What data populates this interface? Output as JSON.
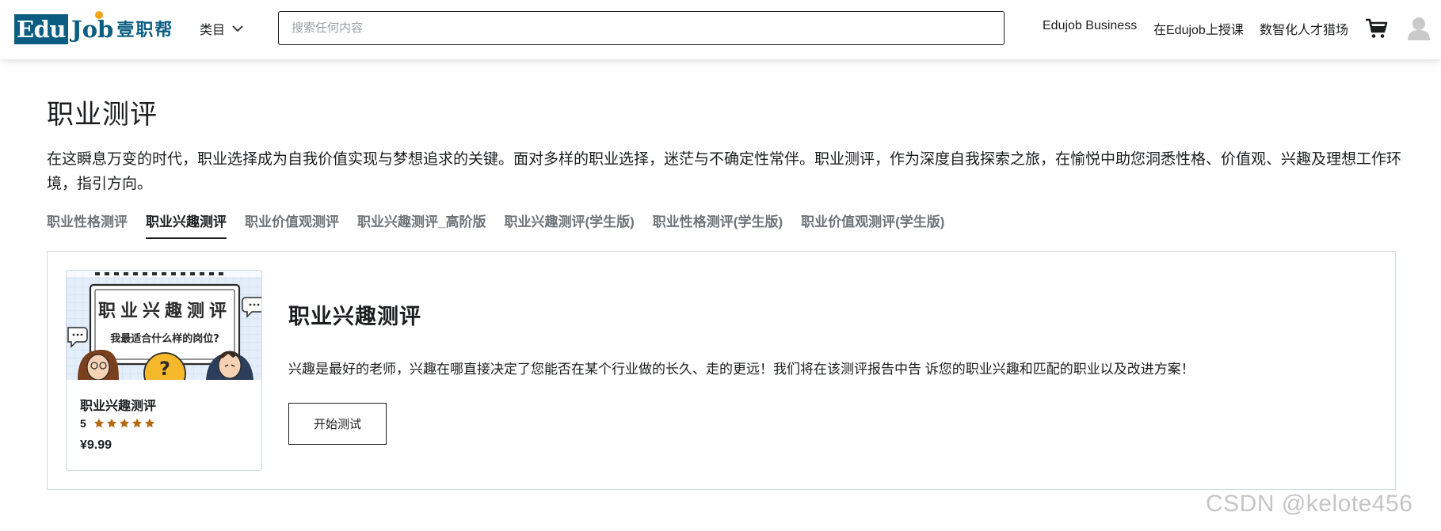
{
  "header": {
    "logo": {
      "edu": "Edu",
      "job": "Job",
      "cn": "壹职帮"
    },
    "category_label": "类目",
    "search_placeholder": "搜索任何内容",
    "links": [
      "Edujob Business",
      "在Edujob上授课",
      "数智化人才猎场"
    ]
  },
  "page": {
    "title": "职业测评",
    "intro": "在这瞬息万变的时代，职业选择成为自我价值实现与梦想追求的关键。面对多样的职业选择，迷茫与不确定性常伴。职业测评，作为深度自我探索之旅，在愉悦中助您洞悉性格、价值观、兴趣及理想工作环境，指引方向。"
  },
  "tabs": [
    {
      "label": "职业性格测评",
      "active": false
    },
    {
      "label": "职业兴趣测评",
      "active": true
    },
    {
      "label": "职业价值观测评",
      "active": false
    },
    {
      "label": "职业兴趣测评_高阶版",
      "active": false
    },
    {
      "label": "职业兴趣测评(学生版)",
      "active": false
    },
    {
      "label": "职业性格测评(学生版)",
      "active": false
    },
    {
      "label": "职业价值观测评(学生版)",
      "active": false
    }
  ],
  "card": {
    "image_heading": "职业兴趣测评",
    "image_subheading": "我最适合什么样的岗位?",
    "image_mark": "?",
    "title": "职业兴趣测评",
    "rating": "5",
    "stars": 5,
    "price": "¥9.99"
  },
  "detail": {
    "title": "职业兴趣测评",
    "description": "兴趣是最好的老师，兴趣在哪直接决定了您能否在某个行业做的长久、走的更远！我们将在该测评报告中告 诉您的职业兴趣和匹配的职业以及改进方案！",
    "button_label": "开始测试"
  },
  "watermark": "CSDN @kelote456",
  "colors": {
    "brand": "#0b5e82",
    "accent": "#f2a516",
    "star": "#b4690e"
  },
  "icons": {
    "category": "chevron-down-icon",
    "cart": "cart-icon",
    "avatar": "user-avatar-icon",
    "star": "star-icon"
  }
}
